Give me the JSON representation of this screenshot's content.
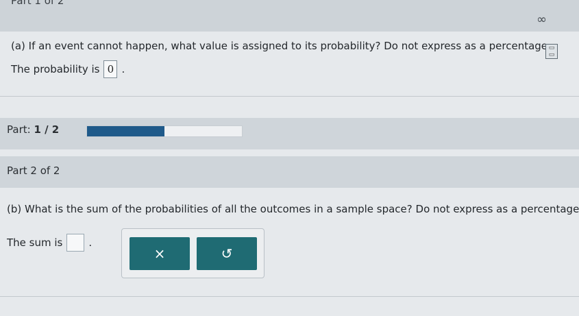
{
  "header": {
    "part_title": "Part 1 of 2",
    "infinity_icon": "∞"
  },
  "part_a": {
    "question": "(a) If an event cannot happen, what value is assigned to its probability? Do not express as a percentage.",
    "answer_prefix": "The probability is",
    "answer_value": "0",
    "answer_suffix": "."
  },
  "progress": {
    "label_prefix": "Part: ",
    "label_value": "1 / 2",
    "fraction": 0.5
  },
  "part_b": {
    "title": "Part 2 of 2",
    "question": "(b) What is the sum of the probabilities of all the outcomes in a sample space? Do not express as a percentage.",
    "answer_prefix": "The sum is",
    "answer_value": "",
    "answer_suffix": "."
  },
  "toolbar": {
    "clear_icon": "×",
    "undo_icon": "↺"
  }
}
